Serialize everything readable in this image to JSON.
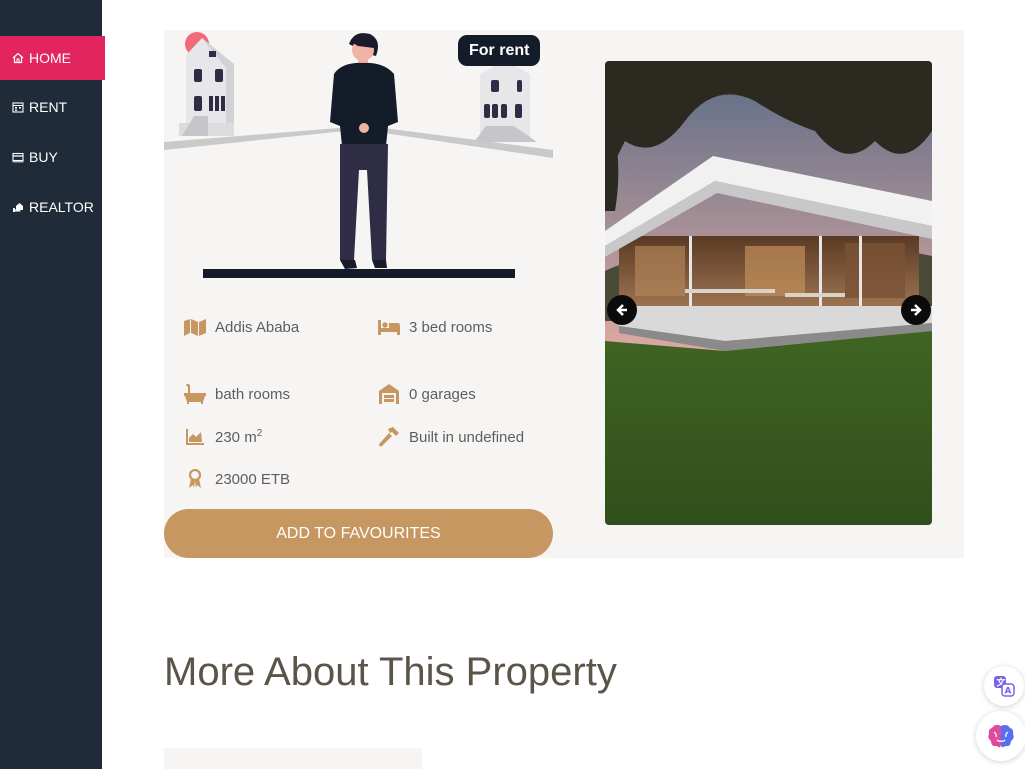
{
  "sidebar": {
    "items": [
      {
        "label": "HOME",
        "icon": "home-icon",
        "active": true
      },
      {
        "label": "RENT",
        "icon": "calendar-icon",
        "active": false
      },
      {
        "label": "BUY",
        "icon": "card-icon",
        "active": false
      },
      {
        "label": "REALTOR",
        "icon": "house-hand-icon",
        "active": false
      }
    ]
  },
  "listing": {
    "badge": "For rent",
    "features": {
      "location": "Addis Ababa",
      "bedrooms": "3 bed rooms",
      "bathrooms": "bath rooms",
      "garages": "0 garages",
      "area": "230 m",
      "area_unit_exp": "2",
      "built": "Built in undefined",
      "price": "23000 ETB"
    },
    "favourite_button": "ADD TO FAVOURITES"
  },
  "section": {
    "more_title": "More About This Property"
  },
  "colors": {
    "sidebar": "#202b3a",
    "active": "#e2255f",
    "accent": "#c69760",
    "card": "#f7f5f4",
    "heading": "#5b5448"
  }
}
